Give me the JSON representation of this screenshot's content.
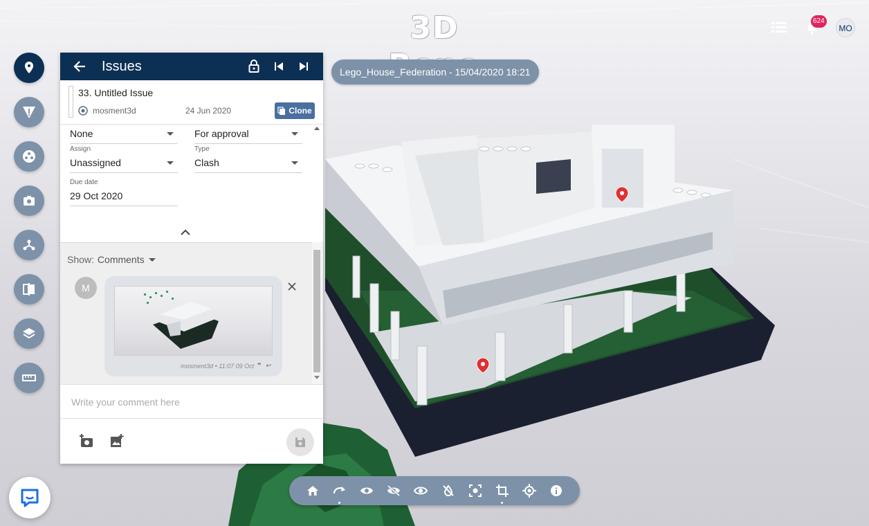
{
  "app": {
    "logo_text": "3D Repo",
    "notifications_count": "624",
    "user_initials": "MO",
    "revision_label": "Lego_House_Federation - 15/04/2020 18:21"
  },
  "left_toolbar": [
    "pin-icon",
    "warning-icon",
    "groups-icon",
    "camera-icon",
    "tree-icon",
    "compare-icon",
    "layers-icon",
    "ruler-icon"
  ],
  "issues_panel": {
    "title": "Issues",
    "issue": {
      "name": "33. Untitled Issue",
      "owner": "mosment3d",
      "date": "24 Jun 2020",
      "clone_label": "Clone"
    },
    "fields": {
      "priority_value": "None",
      "status_value": "For approval",
      "assign_label": "Assign",
      "assign_value": "Unassigned",
      "type_label": "Type",
      "type_value": "Clash",
      "due_label": "Due date",
      "due_value": "29 Oct 2020"
    },
    "comments": {
      "show_label": "Show:",
      "show_value": "Comments",
      "items": [
        {
          "avatar": "M",
          "meta": "mosment3d • 11:07 09 Oct"
        }
      ]
    },
    "comment_placeholder": "Write your comment here"
  },
  "bottom_toolbar": [
    "home-icon",
    "rotate-icon",
    "show-icon",
    "hide-icon",
    "isolate-icon",
    "clip-icon",
    "focus-icon",
    "crop-icon",
    "measure-point-icon",
    "info-icon"
  ],
  "colors": {
    "primary": "#0c2f54",
    "secondary": "#7d92a8",
    "badge": "#e0245e",
    "pin": "#e03030"
  }
}
